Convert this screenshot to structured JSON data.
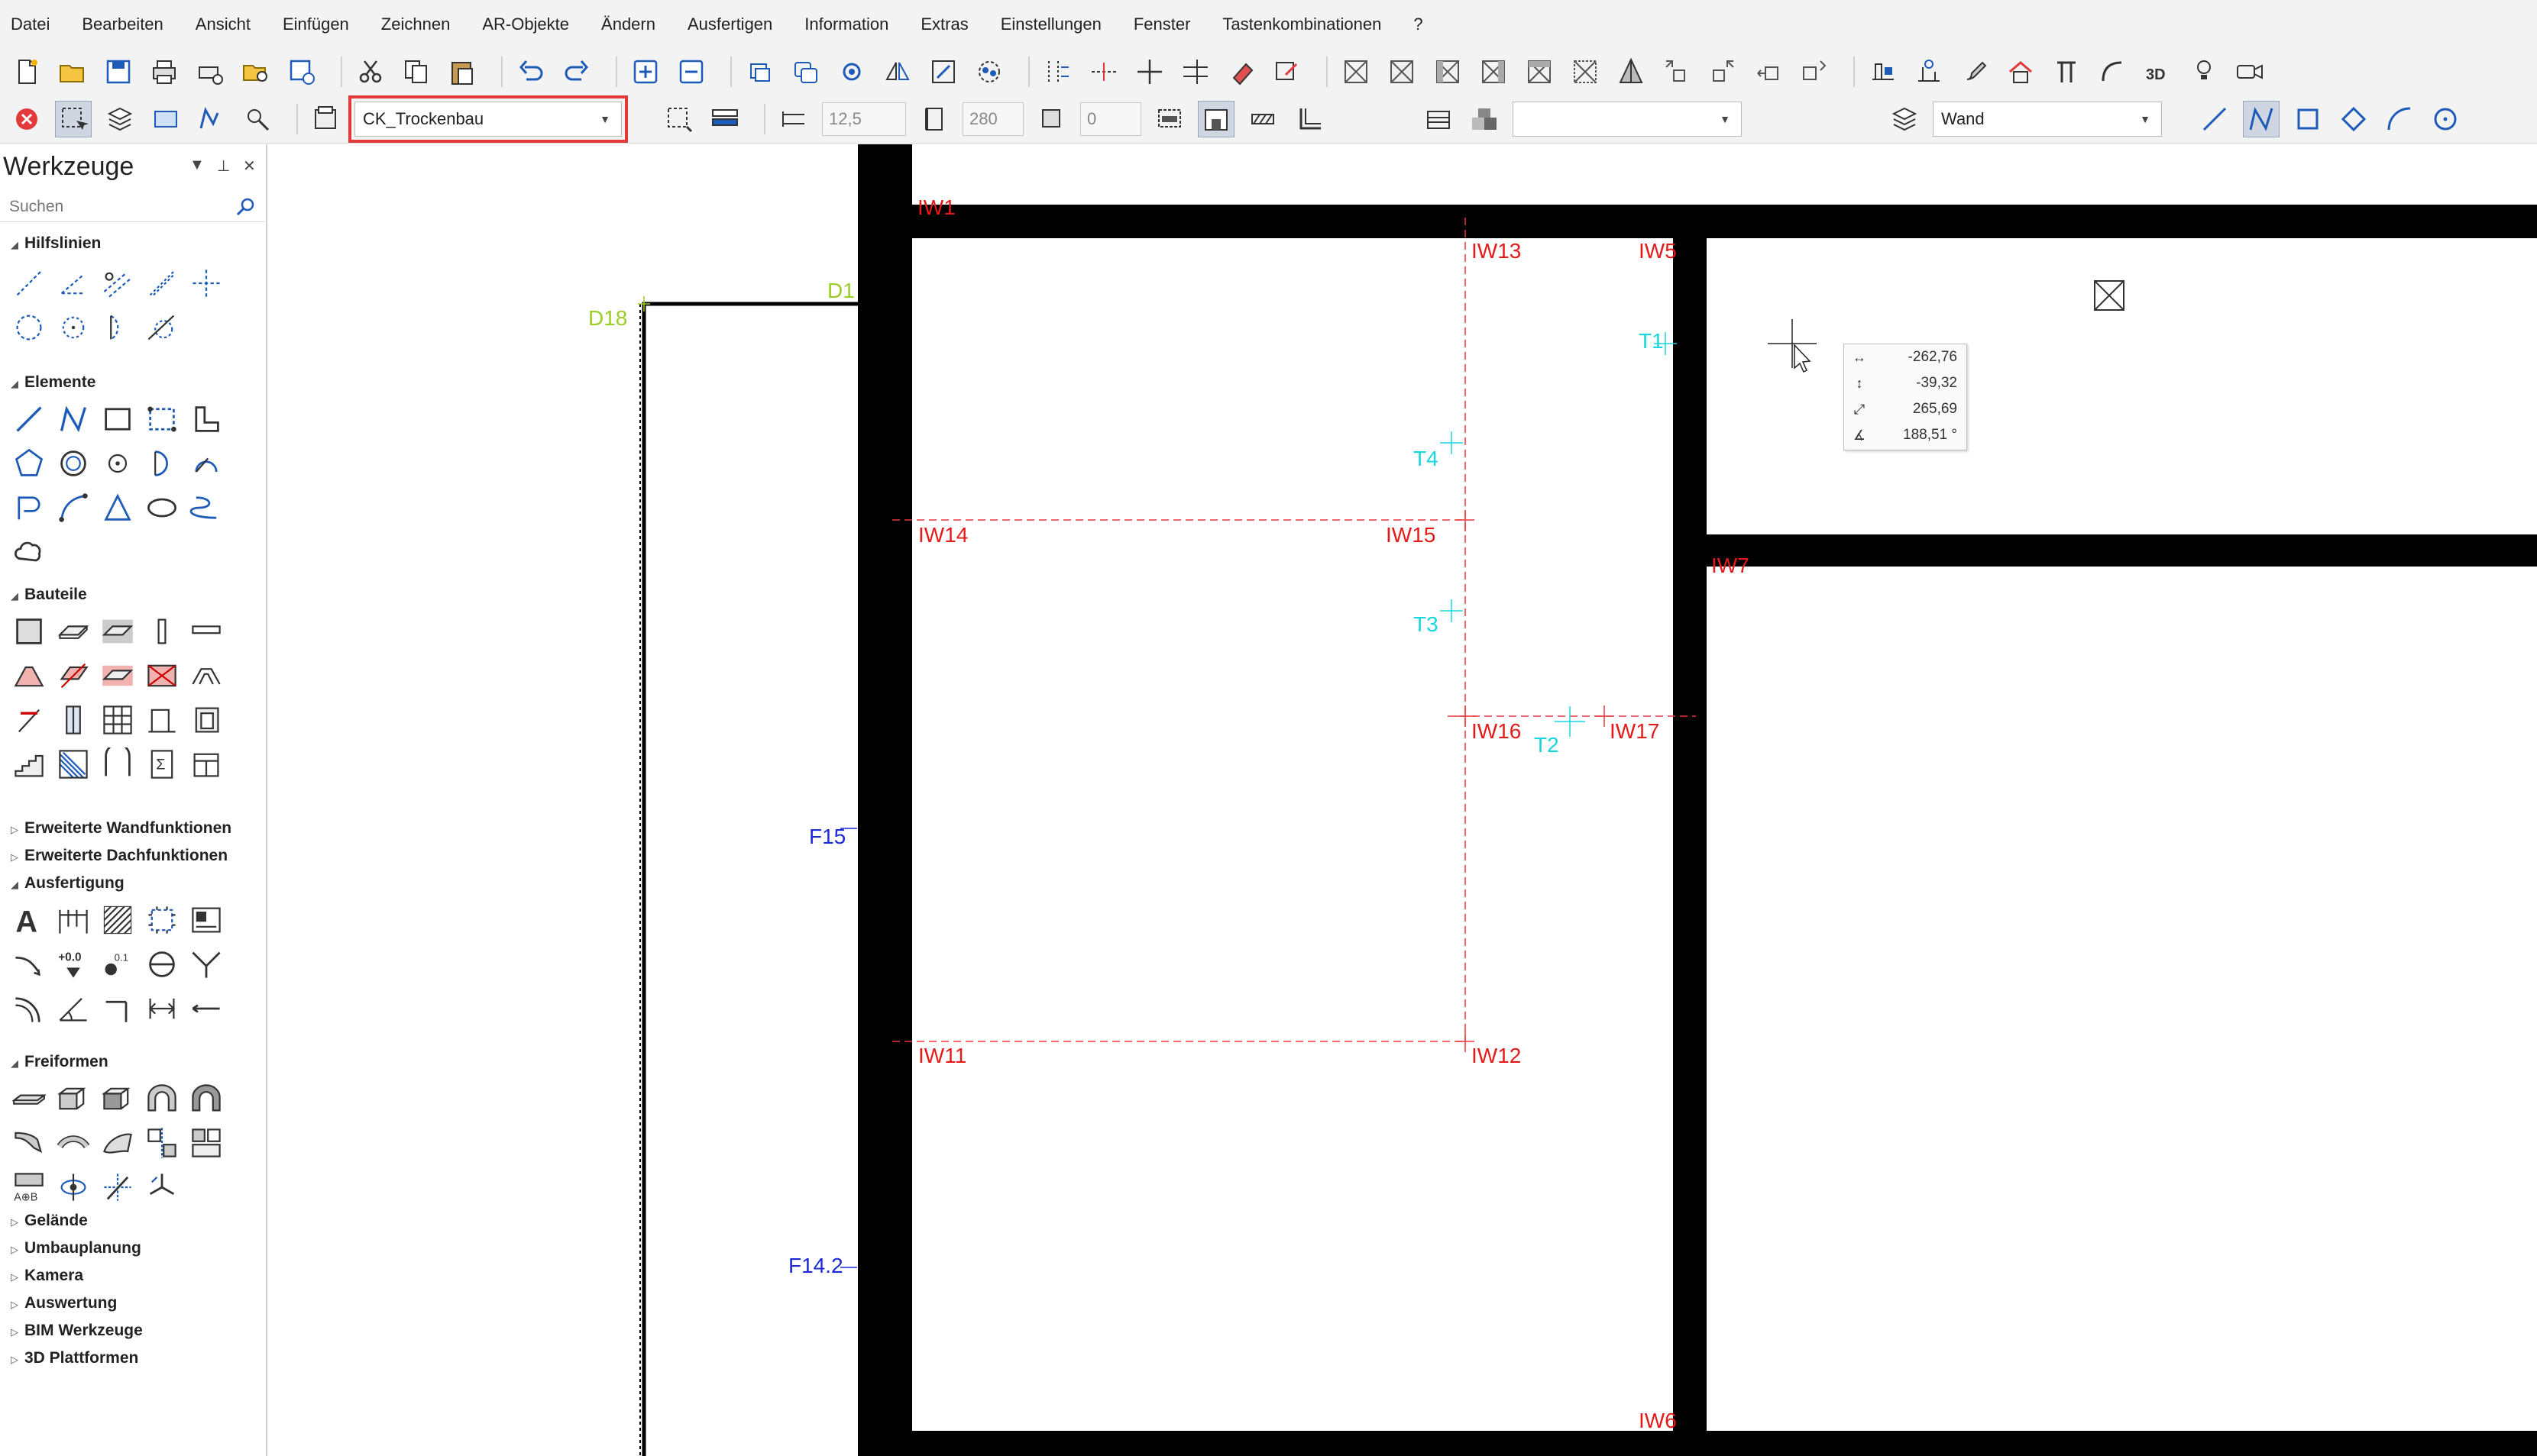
{
  "menu": [
    "Datei",
    "Bearbeiten",
    "Ansicht",
    "Einfügen",
    "Zeichnen",
    "AR-Objekte",
    "Ändern",
    "Ausfertigen",
    "Information",
    "Extras",
    "Einstellungen",
    "Fenster",
    "Tastenkombinationen",
    "?"
  ],
  "toolbar2": {
    "layer_combo": "CK_Trockenbau",
    "thickness_value": "12,5",
    "height_value": "280",
    "offset_value": "0",
    "material_combo": "",
    "type_combo": "Wand"
  },
  "panel": {
    "title": "Werkzeuge",
    "search_placeholder": "Suchen",
    "sections": {
      "hilfslinien": "Hilfslinien",
      "elemente": "Elemente",
      "bauteile": "Bauteile",
      "erw_wand": "Erweiterte Wandfunktionen",
      "erw_dach": "Erweiterte Dachfunktionen",
      "ausfertigung": "Ausfertigung",
      "freiformen": "Freiformen",
      "gelaende": "Gelände",
      "umbauplanung": "Umbauplanung",
      "kamera": "Kamera",
      "auswertung": "Auswertung",
      "bim": "BIM Werkzeuge",
      "plattformen": "3D Plattformen"
    },
    "ausfertigung_glyphs": {
      "text_tool": "A",
      "level_a": "+0.0",
      "level_b": "0.1"
    },
    "freiformen_glyph": "A⊕B"
  },
  "toolbar1_glyphs": {
    "view3d": "3D"
  },
  "drawing": {
    "labels": {
      "iw1": "IW1",
      "iw13": "IW13",
      "iw5": "IW5",
      "iw14": "IW14",
      "iw15": "IW15",
      "iw16": "IW16",
      "iw17": "IW17",
      "iw11": "IW11",
      "iw12": "IW12",
      "iw6": "IW6",
      "iw7": "IW7",
      "t1": "T1",
      "t2": "T2",
      "t3": "T3",
      "t4": "T4",
      "d18": "D18",
      "d1": "D1",
      "f15": "F15",
      "f142": "F14.2"
    },
    "colors": {
      "axis": "#e8393b",
      "iw_label": "#e31b1b",
      "t_label": "#18d6dd",
      "d_label": "#9acd28",
      "f_label": "#1a2ad6"
    }
  },
  "coordinates": {
    "dx": "-262,76",
    "dy": "-39,32",
    "dist": "265,69",
    "angle": "188,51 °"
  }
}
